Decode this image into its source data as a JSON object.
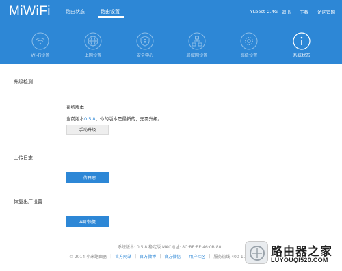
{
  "header": {
    "logo": "MiWiFi",
    "nav": [
      {
        "label": "路由状态",
        "active": false
      },
      {
        "label": "路由设置",
        "active": true
      }
    ],
    "ssid": "YLbest_2.4G",
    "logout": "退出",
    "download": "下载",
    "visit_site": "访问官网"
  },
  "settings_tabs": [
    {
      "label": "Wi-Fi设置",
      "icon": "wifi-icon"
    },
    {
      "label": "上网设置",
      "icon": "globe-icon"
    },
    {
      "label": "安全中心",
      "icon": "shield-icon"
    },
    {
      "label": "局域网设置",
      "icon": "network-icon"
    },
    {
      "label": "高级设置",
      "icon": "gear-icon"
    },
    {
      "label": "系统状态",
      "icon": "info-icon",
      "active": true
    }
  ],
  "upgrade": {
    "title": "升级检测",
    "system_version_label": "系统版本",
    "current_prefix": "当前版本",
    "current_version": "0.5.8",
    "current_suffix": "，你的版本是最新的，无需升级。",
    "manual_upgrade_button": "手动升级"
  },
  "upload_log": {
    "title": "上传日志",
    "button": "上传日志"
  },
  "factory_reset": {
    "title": "恢复出厂设置",
    "button": "立即恢复"
  },
  "footer": {
    "system_info": "系统版本: 0.5.8 稳定版   MAC地址: 8C:BE:BE:46:0B:80",
    "copyright": "© 2014 小米路由器",
    "links": [
      "官方网站",
      "官方微博",
      "官方微信",
      "用户社区"
    ],
    "hotline": "服务热线 400-100-5678"
  },
  "watermark": {
    "title": "路由器之家",
    "url": "LUYOUQI520.COM"
  },
  "colors": {
    "header_bg": "#2d87d6",
    "accent": "#2d87d6"
  }
}
